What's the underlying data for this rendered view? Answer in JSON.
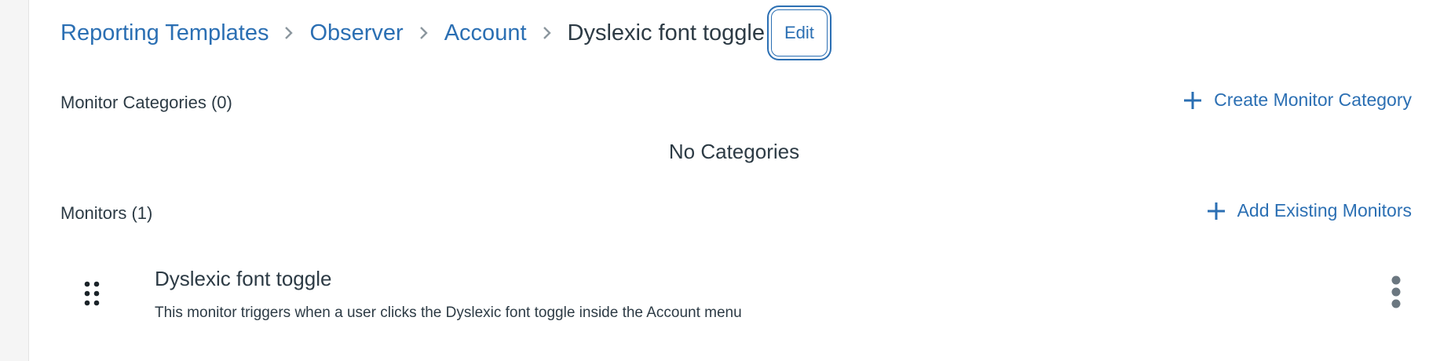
{
  "breadcrumb": {
    "items": [
      {
        "label": "Reporting Templates"
      },
      {
        "label": "Observer"
      },
      {
        "label": "Account"
      }
    ],
    "current": "Dyslexic font toggle",
    "edit_label": "Edit"
  },
  "categories": {
    "title": "Monitor Categories (0)",
    "create_label": "Create Monitor Category",
    "empty_text": "No Categories"
  },
  "monitors": {
    "title": "Monitors (1)",
    "add_label": "Add Existing Monitors",
    "items": [
      {
        "name": "Dyslexic font toggle",
        "description": "This monitor triggers when a user clicks the Dyslexic font toggle inside the Account menu"
      }
    ]
  },
  "icons": {
    "separator": "chevron-right-icon",
    "add": "plus-icon",
    "drag": "drag-handle-icon",
    "more": "kebab-menu-icon"
  },
  "colors": {
    "link": "#2b6fb3",
    "text": "#2d3b45",
    "separator": "#8b969e"
  }
}
